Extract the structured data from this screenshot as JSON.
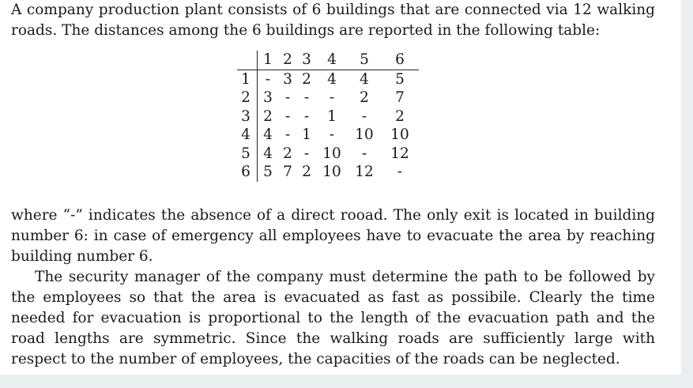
{
  "intro": "A company production plant consists of 6 buildings that are connected via 12 walking roads. The distances among the 6 buildings are reported in the following table:",
  "table": {
    "columns": [
      "1",
      "2",
      "3",
      "4",
      "5",
      "6"
    ],
    "rows": [
      {
        "label": "1",
        "cells": [
          "-",
          "3",
          "2",
          "4",
          "4",
          "5"
        ]
      },
      {
        "label": "2",
        "cells": [
          "3",
          "-",
          "-",
          "-",
          "2",
          "7"
        ]
      },
      {
        "label": "3",
        "cells": [
          "2",
          "-",
          "-",
          "1",
          "-",
          "2"
        ]
      },
      {
        "label": "4",
        "cells": [
          "4",
          "-",
          "1",
          "-",
          "10",
          "10"
        ]
      },
      {
        "label": "5",
        "cells": [
          "4",
          "2",
          "-",
          "10",
          "-",
          "12"
        ]
      },
      {
        "label": "6",
        "cells": [
          "5",
          "7",
          "2",
          "10",
          "12",
          "-"
        ]
      }
    ]
  },
  "paragraph2": "where “-” indicates the absence of a direct rooad. The only exit is located in building number 6: in case of emergency all employees have to evacuate the area by reaching building number 6.",
  "paragraph3": "The security manager of the company must determine the path to be followed by the employees so that the area is evacuated as fast as possibile. Clearly the time needed for evacuation is proportional to the length of the evacuation path and the road lengths are symmetric. Since the walking roads are sufficiently large with respect to the number of employees, the capacities of the roads can be neglected."
}
